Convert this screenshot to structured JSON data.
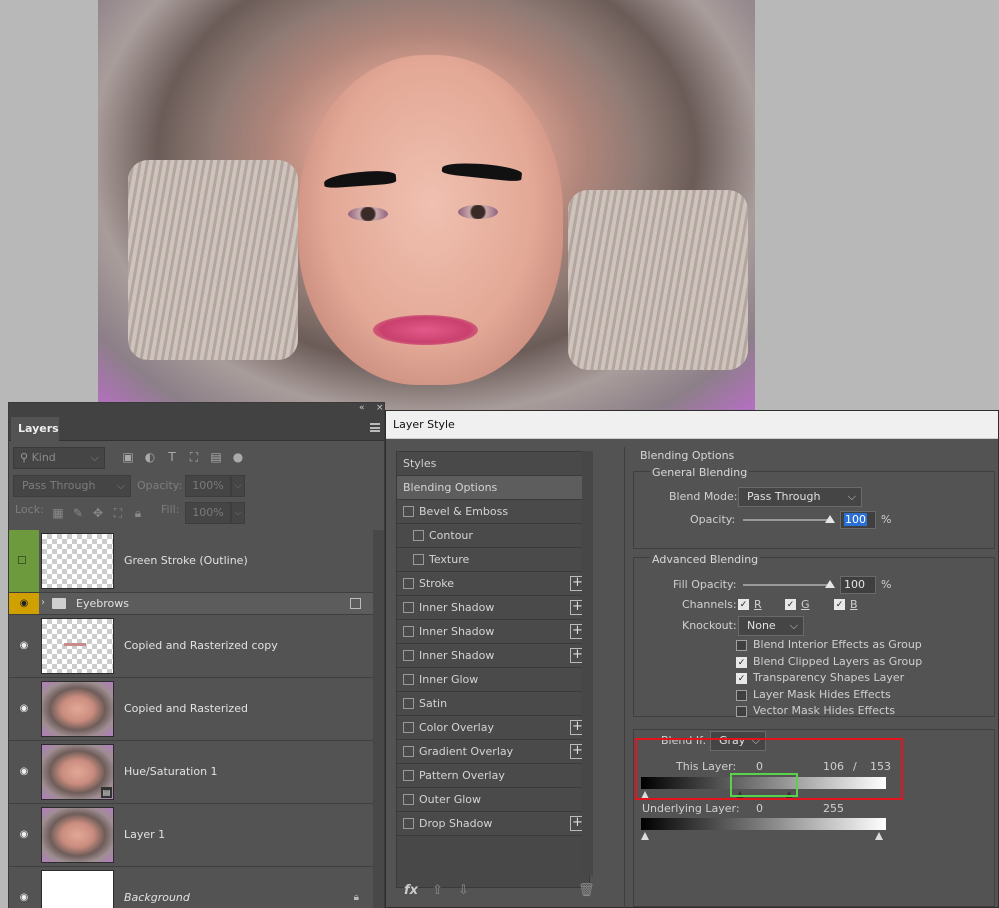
{
  "layers_panel": {
    "tab_label": "Layers",
    "filter_kind": "Kind",
    "blend_mode": "Pass Through",
    "opacity_label": "Opacity:",
    "opacity_value": "100%",
    "lock_label": "Lock:",
    "fill_label": "Fill:",
    "fill_value": "100%",
    "layers": [
      {
        "name": "Green Stroke (Outline)"
      },
      {
        "name": "Eyebrows"
      },
      {
        "name": "Copied and Rasterized copy"
      },
      {
        "name": "Copied and Rasterized"
      },
      {
        "name": "Hue/Saturation 1"
      },
      {
        "name": "Layer 1"
      },
      {
        "name": "Background"
      }
    ]
  },
  "layer_style": {
    "title": "Layer Style",
    "styles_header": "Styles",
    "styles": [
      {
        "label": "Blending Options"
      },
      {
        "label": "Bevel & Emboss"
      },
      {
        "label": "Contour"
      },
      {
        "label": "Texture"
      },
      {
        "label": "Stroke"
      },
      {
        "label": "Inner Shadow"
      },
      {
        "label": "Inner Shadow"
      },
      {
        "label": "Inner Shadow"
      },
      {
        "label": "Inner Glow"
      },
      {
        "label": "Satin"
      },
      {
        "label": "Color Overlay"
      },
      {
        "label": "Gradient Overlay"
      },
      {
        "label": "Pattern Overlay"
      },
      {
        "label": "Outer Glow"
      },
      {
        "label": "Drop Shadow"
      }
    ],
    "footer_fx": "fx",
    "blending": {
      "title": "Blending Options",
      "general_title": "General Blending",
      "blend_mode_label": "Blend Mode:",
      "blend_mode_value": "Pass Through",
      "opacity_label": "Opacity:",
      "opacity_value": "100",
      "percent": "%",
      "advanced_title": "Advanced Blending",
      "fill_opacity_label": "Fill Opacity:",
      "fill_opacity_value": "100",
      "channels_label": "Channels:",
      "channel_r": "R",
      "channel_g": "G",
      "channel_b": "B",
      "knockout_label": "Knockout:",
      "knockout_value": "None",
      "options": [
        {
          "label": "Blend Interior Effects as Group",
          "checked": false
        },
        {
          "label": "Blend Clipped Layers as Group",
          "checked": true
        },
        {
          "label": "Transparency Shapes Layer",
          "checked": true
        },
        {
          "label": "Layer Mask Hides Effects",
          "checked": false
        },
        {
          "label": "Vector Mask Hides Effects",
          "checked": false
        }
      ],
      "blend_if_label": "Blend If:",
      "blend_if_value": "Gray",
      "this_layer_label": "This Layer:",
      "this_layer_low": "0",
      "this_layer_high_a": "106",
      "this_layer_slash": "/",
      "this_layer_high_b": "153",
      "underlying_label": "Underlying Layer:",
      "underlying_low": "0",
      "underlying_high": "255"
    }
  },
  "colors": {
    "highlight_red": "#e3121b",
    "highlight_green": "#5ad14a",
    "layer_selected": "#cfa000",
    "green_layer": "#6c9a3c"
  }
}
